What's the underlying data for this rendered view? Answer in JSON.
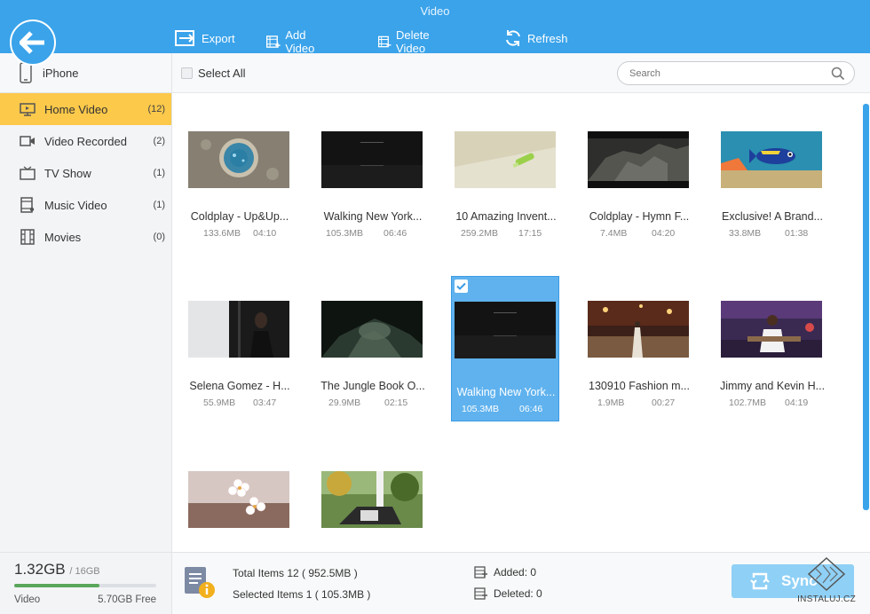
{
  "app": {
    "title": "Video"
  },
  "toolbar": {
    "export_label": "Export",
    "add_label": "Add Video",
    "delete_label": "Delete Video",
    "refresh_label": "Refresh"
  },
  "sidebar": {
    "device": "iPhone",
    "items": [
      {
        "label": "Home Video",
        "count": "(12)",
        "icon": "monitor-icon"
      },
      {
        "label": "Video Recorded",
        "count": "(2)",
        "icon": "video-camera-icon"
      },
      {
        "label": "TV Show",
        "count": "(1)",
        "icon": "tv-icon"
      },
      {
        "label": "Music Video",
        "count": "(1)",
        "icon": "music-video-icon"
      },
      {
        "label": "Movies",
        "count": "(0)",
        "icon": "film-icon"
      }
    ]
  },
  "filter": {
    "select_all": "Select All",
    "search_placeholder": "Search"
  },
  "videos": [
    {
      "title": "Coldplay - Up&Up...",
      "size": "133.6MB",
      "duration": "04:10"
    },
    {
      "title": "Walking New York...",
      "size": "105.3MB",
      "duration": "06:46"
    },
    {
      "title": "10 Amazing Invent...",
      "size": "259.2MB",
      "duration": "17:15"
    },
    {
      "title": "Coldplay - Hymn F...",
      "size": "7.4MB",
      "duration": "04:20"
    },
    {
      "title": "Exclusive! A Brand...",
      "size": "33.8MB",
      "duration": "01:38"
    },
    {
      "title": "Selena Gomez - H...",
      "size": "55.9MB",
      "duration": "03:47"
    },
    {
      "title": "The Jungle Book O...",
      "size": "29.9MB",
      "duration": "02:15"
    },
    {
      "title": "Walking New York...",
      "size": "105.3MB",
      "duration": "06:46",
      "selected": true
    },
    {
      "title": "130910 Fashion m...",
      "size": "1.9MB",
      "duration": "00:27"
    },
    {
      "title": "Jimmy and Kevin H...",
      "size": "102.7MB",
      "duration": "04:19"
    },
    {
      "title": "",
      "size": "",
      "duration": ""
    },
    {
      "title": "",
      "size": "",
      "duration": ""
    }
  ],
  "storage": {
    "used": "1.32GB",
    "total": "/ 16GB",
    "label": "Video",
    "free": "5.70GB Free",
    "fill_fraction": 0.6
  },
  "footer": {
    "total_items": "Total Items 12 ( 952.5MB )",
    "selected_items": "Selected Items 1 ( 105.3MB )",
    "added": "Added: 0",
    "deleted": "Deleted: 0",
    "sync_label": "Sync",
    "watermark": "INSTALUJ.CZ"
  },
  "colors": {
    "header": "#3aa3ea",
    "active": "#fcc94a",
    "selected": "#5fb2ee"
  }
}
